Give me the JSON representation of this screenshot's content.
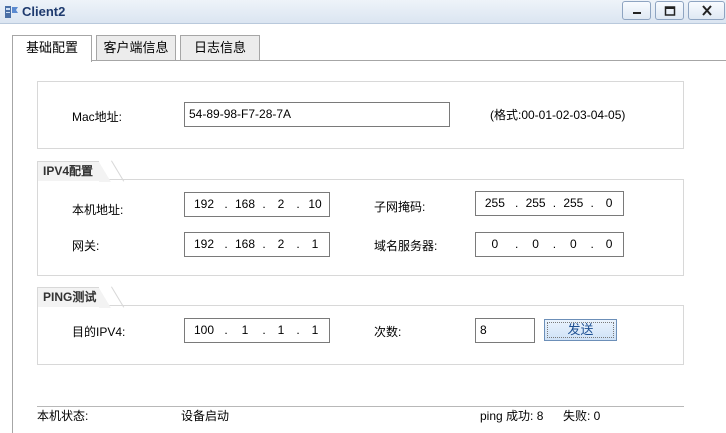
{
  "window": {
    "title": "Client2",
    "icons": [
      "app-icon",
      "minimize-icon",
      "maximize-icon",
      "close-icon"
    ]
  },
  "tabs": [
    {
      "label": "基础配置",
      "active": true
    },
    {
      "label": "客户端信息",
      "active": false
    },
    {
      "label": "日志信息",
      "active": false
    }
  ],
  "mac": {
    "label": "Mac地址:",
    "value": "54-89-98-F7-28-7A",
    "hint": "(格式:00-01-02-03-04-05)"
  },
  "ipv4": {
    "section_title": "IPV4配置",
    "local_ip_label": "本机地址:",
    "local_ip": [
      "192",
      "168",
      "2",
      "10"
    ],
    "mask_label": "子网掩码:",
    "mask": [
      "255",
      "255",
      "255",
      "0"
    ],
    "gateway_label": "网关:",
    "gateway": [
      "192",
      "168",
      "2",
      "1"
    ],
    "dns_label": "域名服务器:",
    "dns": [
      "0",
      "0",
      "0",
      "0"
    ]
  },
  "ping": {
    "section_title": "PING测试",
    "dest_label": "目的IPV4:",
    "dest": [
      "100",
      "1",
      "1",
      "1"
    ],
    "count_label": "次数:",
    "count": "8",
    "send_label": "发送"
  },
  "status": {
    "label": "本机状态:",
    "value": "设备启动",
    "ping_success": "ping 成功: 8",
    "fail": "失败: 0"
  }
}
